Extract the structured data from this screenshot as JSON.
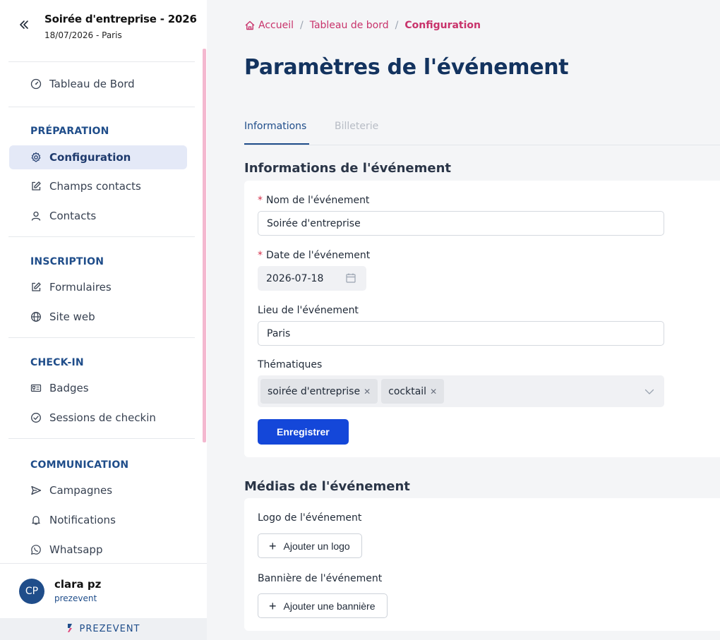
{
  "event": {
    "title": "Soirée d'entreprise - 2026",
    "subtitle": "18/07/2026 - Paris"
  },
  "sidebar": {
    "dashboard": "Tableau de Bord",
    "sections": {
      "preparation": "PRÉPARATION",
      "inscription": "INSCRIPTION",
      "checkin": "CHECK-IN",
      "communication": "COMMUNICATION"
    },
    "items": {
      "configuration": "Configuration",
      "champs_contacts": "Champs contacts",
      "contacts": "Contacts",
      "formulaires": "Formulaires",
      "site_web": "Site web",
      "badges": "Badges",
      "sessions_checkin": "Sessions de checkin",
      "campagnes": "Campagnes",
      "notifications": "Notifications",
      "whatsapp": "Whatsapp"
    }
  },
  "user": {
    "initials": "CP",
    "name": "clara pz",
    "org": "prezevent"
  },
  "brand": {
    "name": "PREZEVENT",
    "color": "#1f4d8a"
  },
  "breadcrumb": {
    "home": "Accueil",
    "dashboard": "Tableau de bord",
    "current": "Configuration"
  },
  "page": {
    "title": "Paramètres de l'événement"
  },
  "tabs": {
    "informations": "Informations",
    "billeterie": "Billeterie"
  },
  "info_section": {
    "title": "Informations de l'événement",
    "name_label": "Nom de l'événement",
    "name_value": "Soirée d'entreprise",
    "date_label": "Date de l'événement",
    "date_value": "2026-07-18",
    "place_label": "Lieu de l'événement",
    "place_value": "Paris",
    "themes_label": "Thématiques",
    "themes": [
      "soirée d'entreprise",
      "cocktail"
    ],
    "save_button": "Enregistrer"
  },
  "media_section": {
    "title": "Médias de l'événement",
    "logo_label": "Logo de l'événement",
    "logo_button": "Ajouter un logo",
    "banner_label": "Bannière de l'événement",
    "banner_button": "Ajouter une bannière"
  },
  "colors": {
    "accent": "#c8336b",
    "primary": "#1447d9",
    "navy": "#13335f"
  }
}
